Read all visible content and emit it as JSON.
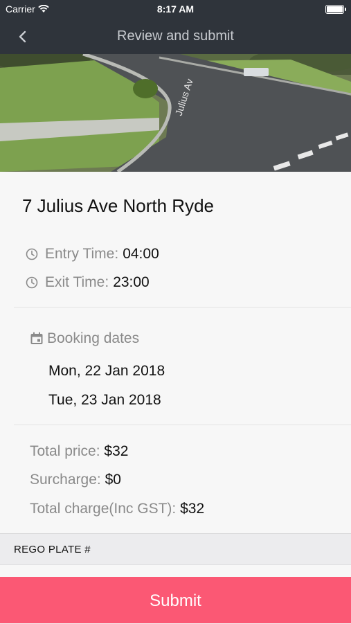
{
  "status_bar": {
    "carrier": "Carrier",
    "time": "8:17 AM",
    "battery_level": 1.0
  },
  "nav": {
    "back_icon": "chevron-left-icon",
    "title": "Review and submit"
  },
  "hero_image": {
    "street_sign": "Julius Av"
  },
  "parking": {
    "address": "7 Julius Ave North Ryde",
    "entry_label": "Entry Time:",
    "entry_value": "04:00",
    "exit_label": "Exit Time:",
    "exit_value": "23:00"
  },
  "booking": {
    "label": "Booking dates",
    "dates": [
      "Mon, 22 Jan 2018",
      "Tue, 23 Jan 2018"
    ]
  },
  "pricing": {
    "total_price_label": "Total price:",
    "total_price_value": "$32",
    "surcharge_label": "Surcharge:",
    "surcharge_value": "$0",
    "total_charge_label": "Total charge(Inc GST):",
    "total_charge_value": "$32"
  },
  "rego": {
    "label": "REGO PLATE #"
  },
  "submit": {
    "label": "Submit"
  },
  "colors": {
    "nav_bg": "#2f343b",
    "submit_bg": "#fb5874",
    "page_bg": "#f7f7f7"
  }
}
